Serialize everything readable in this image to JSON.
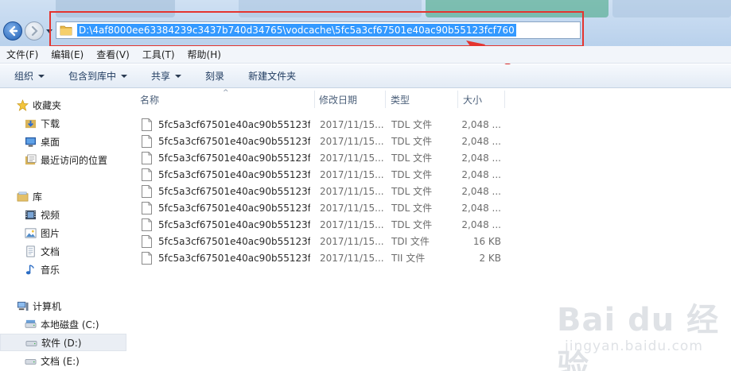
{
  "window": {
    "address_path": "D:\\4af8000ee63384239c3437b740d34765\\vodcache\\5fc5a3cf67501e40ac90b55123fcf760"
  },
  "menu": {
    "items": [
      "文件(F)",
      "编辑(E)",
      "查看(V)",
      "工具(T)",
      "帮助(H)"
    ]
  },
  "toolbar": {
    "organize": "组织",
    "include_library": "包含到库中",
    "share": "共享",
    "burn": "刻录",
    "new_folder": "新建文件夹"
  },
  "nav": {
    "favorites": "收藏夹",
    "downloads": "下载",
    "desktop": "桌面",
    "recent": "最近访问的位置",
    "libraries": "库",
    "videos": "视频",
    "pictures": "图片",
    "documents": "文档",
    "music": "音乐",
    "computer": "计算机",
    "drive_c": "本地磁盘 (C:)",
    "drive_d": "软件 (D:)",
    "drive_e": "文档 (E:)"
  },
  "columns": {
    "name": "名称",
    "modified": "修改日期",
    "type": "类型",
    "size": "大小"
  },
  "files": [
    {
      "name": "5fc5a3cf67501e40ac90b55123f...",
      "date": "2017/11/15...",
      "type": "TDL 文件",
      "size": "2,048 ..."
    },
    {
      "name": "5fc5a3cf67501e40ac90b55123f...",
      "date": "2017/11/15...",
      "type": "TDL 文件",
      "size": "2,048 ..."
    },
    {
      "name": "5fc5a3cf67501e40ac90b55123f...",
      "date": "2017/11/15...",
      "type": "TDL 文件",
      "size": "2,048 ..."
    },
    {
      "name": "5fc5a3cf67501e40ac90b55123f...",
      "date": "2017/11/15...",
      "type": "TDL 文件",
      "size": "2,048 ..."
    },
    {
      "name": "5fc5a3cf67501e40ac90b55123f...",
      "date": "2017/11/15...",
      "type": "TDL 文件",
      "size": "2,048 ..."
    },
    {
      "name": "5fc5a3cf67501e40ac90b55123f...",
      "date": "2017/11/15...",
      "type": "TDL 文件",
      "size": "2,048 ..."
    },
    {
      "name": "5fc5a3cf67501e40ac90b55123f...",
      "date": "2017/11/15...",
      "type": "TDL 文件",
      "size": "2,048 ..."
    },
    {
      "name": "5fc5a3cf67501e40ac90b55123f...",
      "date": "2017/11/15...",
      "type": "TDI 文件",
      "size": "16 KB"
    },
    {
      "name": "5fc5a3cf67501e40ac90b55123f...",
      "date": "2017/11/15...",
      "type": "TII 文件",
      "size": "2 KB"
    }
  ],
  "watermark": {
    "logo": "Bai du 经验",
    "url": "jingyan.baidu.com"
  },
  "colors": {
    "selection": "#3399ff",
    "highlight_box": "#e4342f"
  }
}
